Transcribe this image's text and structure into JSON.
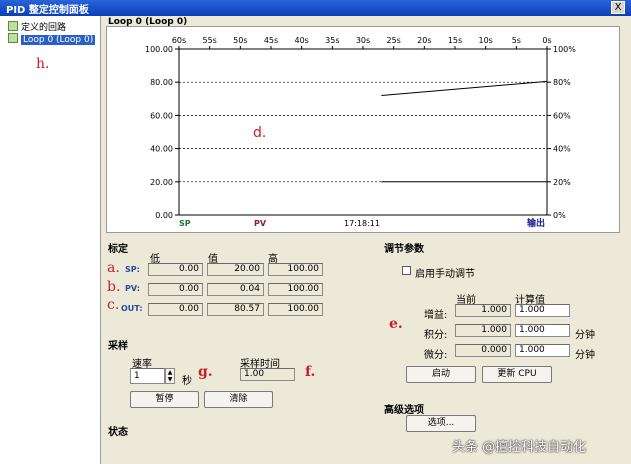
{
  "window": {
    "title": "PID 整定控制面板",
    "close_label": "X"
  },
  "tree": {
    "root_label": "定义的回路",
    "selected_label": "Loop 0 (Loop 0)"
  },
  "chart_header": "Loop 0 (Loop 0)",
  "annotations": {
    "a": "a.",
    "b": "b.",
    "c": "c.",
    "d": "d.",
    "e": "e.",
    "f": "f.",
    "g": "g.",
    "h": "h."
  },
  "chart_data": {
    "type": "line",
    "x_ticks": [
      "60s",
      "55s",
      "50s",
      "45s",
      "40s",
      "35s",
      "30s",
      "25s",
      "20s",
      "15s",
      "10s",
      "5s",
      "0s"
    ],
    "y_ticks_left": [
      "100.00",
      "80.00",
      "60.00",
      "40.00",
      "20.00",
      "0.00"
    ],
    "y_ticks_right": [
      "100%",
      "80%",
      "60%",
      "40%",
      "20%",
      "0%"
    ],
    "ylim": [
      0,
      100
    ],
    "xlim": [
      60,
      0
    ],
    "grid": true,
    "legend": {
      "sp": "SP",
      "pv": "PV",
      "time": "17:18:11",
      "out": "输出"
    },
    "series": [
      {
        "color": "#000000",
        "x": [
          27,
          0
        ],
        "y": [
          72,
          80.5
        ]
      },
      {
        "color": "#000000",
        "x": [
          27,
          0
        ],
        "y": [
          20,
          20
        ]
      }
    ]
  },
  "tuning": {
    "title": "标定",
    "col_low": "低",
    "col_value": "值",
    "col_high": "高",
    "rows": [
      {
        "label": "SP:",
        "low": "0.00",
        "value": "20.00",
        "high": "100.00"
      },
      {
        "label": "PV:",
        "low": "0.00",
        "value": "0.04",
        "high": "100.00"
      },
      {
        "label": "OUT:",
        "low": "0.00",
        "value": "80.57",
        "high": "100.00"
      }
    ]
  },
  "sampling": {
    "title": "采样",
    "rate_label": "速率",
    "rate_value": "1",
    "rate_unit": "秒",
    "time_label": "采样时间",
    "time_value": "1.00",
    "pause_label": "暂停",
    "clear_label": "清除"
  },
  "status": {
    "title": "状态"
  },
  "params": {
    "title": "调节参数",
    "manual_label": "启用手动调节",
    "manual_checked": false,
    "col_current": "当前",
    "col_calc": "计算值",
    "rows": [
      {
        "label": "增益:",
        "current": "1.000",
        "calc": "1.000",
        "unit": ""
      },
      {
        "label": "积分:",
        "current": "1.000",
        "calc": "1.000",
        "unit": "分钟"
      },
      {
        "label": "微分:",
        "current": "0.000",
        "calc": "1.000",
        "unit": "分钟"
      }
    ],
    "start_label": "启动",
    "update_label": "更新 CPU"
  },
  "advanced": {
    "title": "高级选项",
    "options_label": "选项..."
  },
  "watermark": "头条 @擅控科技自动化"
}
